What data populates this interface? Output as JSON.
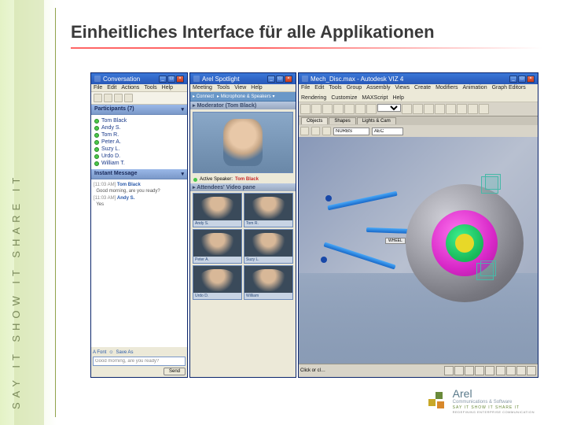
{
  "slide": {
    "title": "Einheitliches Interface für alle Applikationen",
    "side_text": "SAY IT   SHOW IT   SHARE IT"
  },
  "conversation": {
    "title": "Conversation",
    "menu": [
      "File",
      "Edit",
      "Actions",
      "Tools",
      "Help"
    ],
    "participants_label": "Participants (7)",
    "participants": [
      "Tom Black",
      "Andy S.",
      "Tom R.",
      "Peter A.",
      "Suzy L.",
      "Urdo D.",
      "William T."
    ],
    "im_label": "Instant Message",
    "messages": [
      {
        "time": "[11:03 AM]",
        "who": "Tom Black",
        "text": "Good morning, are you ready?"
      },
      {
        "time": "[11:03 AM]",
        "who": "Andy S.",
        "text": "Yes"
      }
    ],
    "font_label": "A Font",
    "save_label": "Save As",
    "compose_placeholder": "Good morning, are you ready?",
    "send_label": "Send"
  },
  "spotlight": {
    "title": "Arel Spotlight",
    "menu": [
      "Meeting",
      "Tools",
      "View",
      "Help"
    ],
    "tool_connect": "Connect",
    "tool_mic": "Microphone & Speakers",
    "moderator_label": "Moderator (Tom Black)",
    "active_speaker_label": "Active Speaker:",
    "active_speaker_name": "Tom Black",
    "attendees_label": "Attendees' Video pane",
    "attendees": [
      "Andy S.",
      "Tom R.",
      "Peter A.",
      "Suzy L.",
      "Urdo D.",
      "William"
    ]
  },
  "viz": {
    "title": "Mech_Disc.max - Autodesk VIZ 4",
    "menu": [
      "File",
      "Edit",
      "Tools",
      "Group",
      "Assembly",
      "Views",
      "Create",
      "Modifiers",
      "Animation",
      "Graph Editors"
    ],
    "menu2": [
      "Rendering",
      "Customize",
      "MAXScript",
      "Help"
    ],
    "tabs": [
      "Objects",
      "Shapes",
      "Lights & Cam"
    ],
    "dropdown1": "All",
    "dropdown2": "NURBS",
    "dropdown3": "AEC",
    "badge": "WHEEL",
    "coords": {
      "x": "",
      "y": "",
      "z": ""
    },
    "status": "Click or cl…"
  },
  "logo": {
    "name": "Arel",
    "sub": "Communications\n& Software",
    "tag": "SAY IT  SHOW IT  SHARE IT",
    "tag2": "REDEFINING ENTERPRISE COMMUNICATION"
  }
}
